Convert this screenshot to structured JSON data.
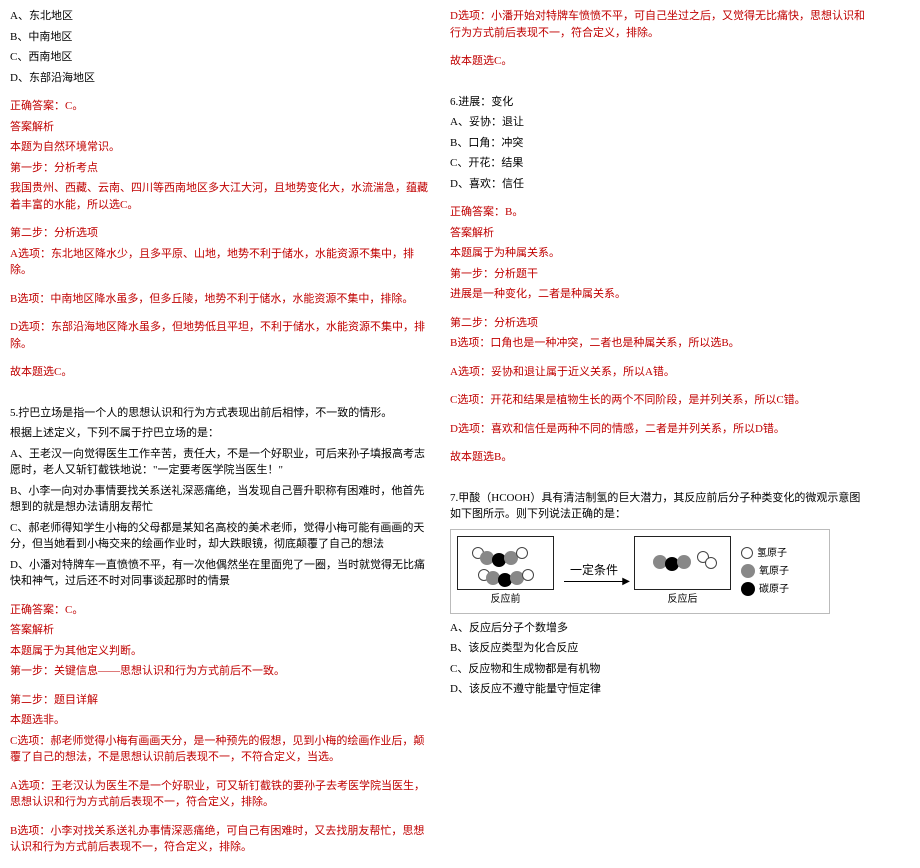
{
  "left": {
    "opts": [
      "A、东北地区",
      "B、中南地区",
      "C、西南地区",
      "D、东部沿海地区"
    ],
    "ans": "正确答案：C。",
    "jx": "答案解析",
    "l1": "本题为自然环境常识。",
    "l2": "第一步：分析考点",
    "l3": "我国贵州、西藏、云南、四川等西南地区多大江大河，且地势变化大，水流湍急，蕴藏着丰富的水能，所以选C。",
    "l4": "第二步：分析选项",
    "lA": "A选项：东北地区降水少，且多平原、山地，地势不利于储水，水能资源不集中，排除。",
    "lB": "B选项：中南地区降水虽多，但多丘陵，地势不利于储水，水能资源不集中，排除。",
    "lD": "D选项：东部沿海地区降水虽多，但地势低且平坦，不利于储水，水能资源不集中，排除。",
    "lEnd": "故本题选C。",
    "q5a": "5.拧巴立场是指一个人的思想认识和行为方式表现出前后相悖，不一致的情形。",
    "q5b": "根据上述定义，下列不属于拧巴立场的是：",
    "q5A": "A、王老汉一向觉得医生工作辛苦，责任大，不是一个好职业，可后来孙子填报高考志愿时，老人又斩钉截铁地说：\"一定要考医学院当医生！\"",
    "q5B": "B、小李一向对办事情要找关系送礼深恶痛绝，当发现自己晋升职称有困难时，他首先想到的就是想办法请朋友帮忙",
    "q5C": "C、郝老师得知学生小梅的父母都是某知名高校的美术老师，觉得小梅可能有画画的天分，但当她看到小梅交来的绘画作业时，却大跌眼镜，彻底颠覆了自己的想法",
    "q5D": "D、小潘对特牌车一直愤愤不平，有一次他偶然坐在里面兜了一圈，当时就觉得无比痛快和神气，过后还不时对同事谈起那时的情景",
    "ans2": "正确答案：C。",
    "jx2": "答案解析",
    "s1": "本题属于为其他定义判断。",
    "s2": "第一步：关键信息——思想认识和行为方式前后不一致。",
    "s3": "第二步：题目详解",
    "s4": "本题选非。",
    "sC": "C选项：郝老师觉得小梅有画画天分，是一种预先的假想，见到小梅的绘画作业后，颠覆了自己的想法，不是思想认识前后表现不一，不符合定义，当选。",
    "sA": "A选项：王老汉认为医生不是一个好职业，可又斩钉截铁的要孙子去考医学院当医生，思想认识和行为方式前后表现不一，符合定义，排除。",
    "sB": "B选项：小李对找关系送礼办事情深恶痛绝，可自己有困难时，又去找朋友帮忙，思想认识和行为方式前后表现不一，符合定义，排除。"
  },
  "right": {
    "rD": "D选项：小潘开始对特牌车愤愤不平，可自己坐过之后，又觉得无比痛快，思想认识和行为方式前后表现不一，符合定义，排除。",
    "rEnd": "故本题选C。",
    "q6t": "6.进展：变化",
    "q6A": "A、妥协：退让",
    "q6B": "B、口角：冲突",
    "q6C": "C、开花：结果",
    "q6D": "D、喜欢：信任",
    "ans6": "正确答案：B。",
    "jx6": "答案解析",
    "r61": "本题属于为种属关系。",
    "r62": "第一步：分析题干",
    "r63": "进展是一种变化，二者是种属关系。",
    "r64": "第二步：分析选项",
    "r6B": "B选项：口角也是一种冲突，二者也是种属关系，所以选B。",
    "r6A": "A选项：妥协和退让属于近义关系，所以A错。",
    "r6C": "C选项：开花和结果是植物生长的两个不同阶段，是并列关系，所以C错。",
    "r6D": "D选项：喜欢和信任是两种不同的情感，二者是并列关系，所以D错。",
    "r6End": "故本题选B。",
    "q7a": "7.甲酸（HCOOH）具有清洁制氢的巨大潜力，其反应前后分子种类变化的微观示意图如下图所示。则下列说法正确的是：",
    "legH": "氢原子",
    "legO": "氧原子",
    "legC": "碳原子",
    "arr": "一定条件",
    "capL": "反应前",
    "capR": "反应后",
    "q7A": "A、反应后分子个数增多",
    "q7B": "B、该反应类型为化合反应",
    "q7C": "C、反应物和生成物都是有机物",
    "q7D": "D、该反应不遵守能量守恒定律"
  }
}
